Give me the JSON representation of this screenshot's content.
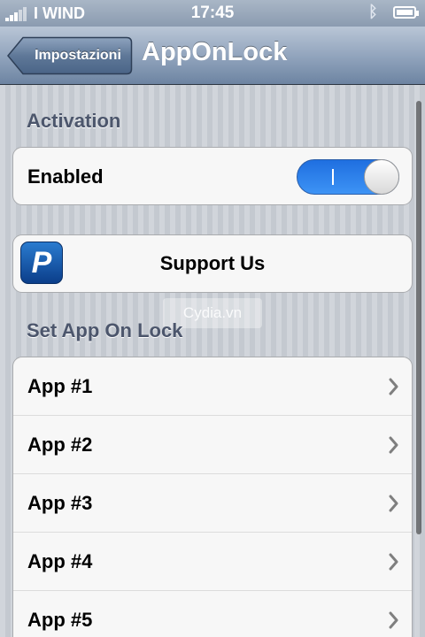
{
  "status_bar": {
    "carrier": "I WIND",
    "time": "17:45",
    "bluetooth_icon": "bluetooth-icon",
    "battery_icon": "battery-icon"
  },
  "nav": {
    "back_label": "Impostazioni",
    "title": "AppOnLock"
  },
  "activation": {
    "header": "Activation",
    "enabled_label": "Enabled",
    "enabled_toggle_text": "I",
    "enabled_value": true,
    "toggle_color": "#2f86ef"
  },
  "support": {
    "label": "Support Us",
    "icon": "paypal-icon",
    "icon_letter": "P"
  },
  "watermark": "Cydia.vn",
  "apps": {
    "header": "Set App On Lock",
    "items": [
      {
        "label": "App #1"
      },
      {
        "label": "App #2"
      },
      {
        "label": "App #3"
      },
      {
        "label": "App #4"
      },
      {
        "label": "App #5"
      }
    ]
  }
}
